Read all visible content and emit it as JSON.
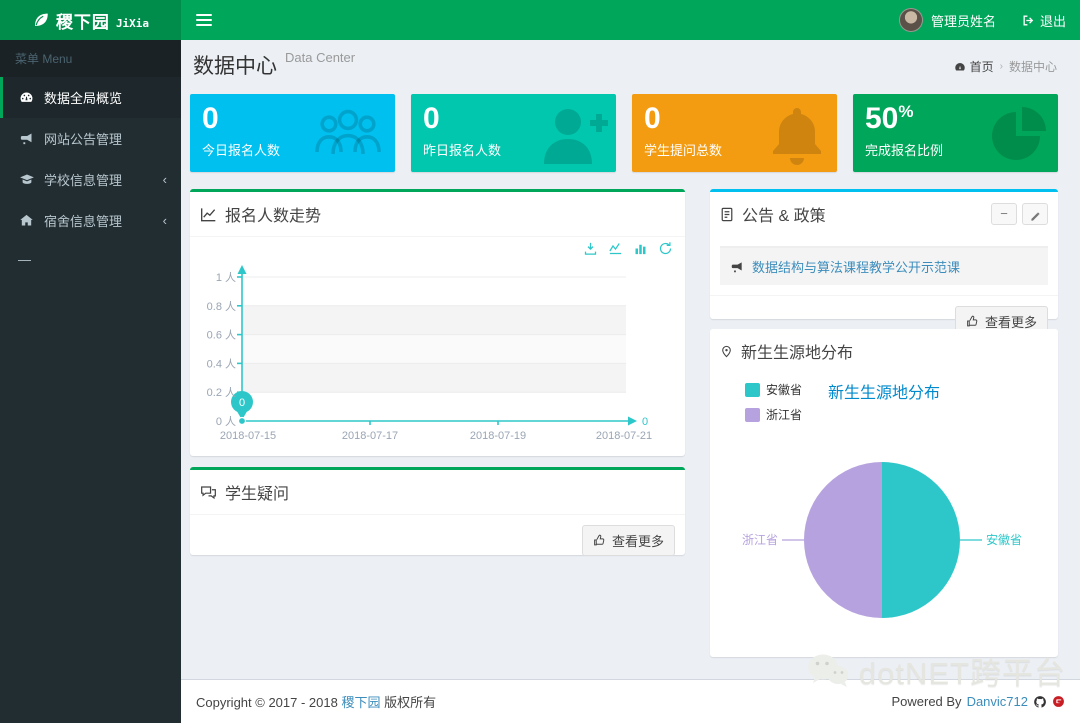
{
  "header": {
    "logo_title": "稷下园",
    "logo_sub": "JiXia",
    "user_name": "管理员姓名",
    "logout_label": "退出"
  },
  "sidebar": {
    "menu_header": "菜单 Menu",
    "items": [
      {
        "label": "数据全局概览",
        "icon": "dashboard-icon",
        "active": true
      },
      {
        "label": "网站公告管理",
        "icon": "bullhorn-icon"
      },
      {
        "label": "学校信息管理",
        "icon": "graduation-cap-icon",
        "expandable": true
      },
      {
        "label": "宿舍信息管理",
        "icon": "home-icon",
        "expandable": true
      },
      {
        "label": "—"
      }
    ]
  },
  "content_header": {
    "title": "数据中心",
    "subtitle": "Data Center",
    "breadcrumb_home": "首页",
    "breadcrumb_current": "数据中心"
  },
  "stat_boxes": [
    {
      "value": "0",
      "label": "今日报名人数",
      "color": "#00c0ef",
      "icon": "users-icon"
    },
    {
      "value": "0",
      "label": "昨日报名人数",
      "color": "#00c7ae",
      "icon": "user-plus-icon"
    },
    {
      "value": "0",
      "label": "学生提问总数",
      "color": "#f39c12",
      "icon": "bell-icon"
    },
    {
      "value": "50",
      "unit": "%",
      "label": "完成报名比例",
      "color": "#00a65a",
      "icon": "pie-chart-icon"
    }
  ],
  "trend_panel": {
    "title": "报名人数走势",
    "toolbox": [
      "download-icon",
      "line-chart-icon",
      "bar-chart-icon",
      "refresh-icon"
    ]
  },
  "announcement_panel": {
    "title": "公告 & 政策",
    "items": [
      {
        "text": "数据结构与算法课程教学公开示范课"
      }
    ],
    "more_label": "查看更多",
    "minus_label": "−"
  },
  "origin_panel": {
    "title": "新生生源地分布",
    "chart_title": "新生生源地分布"
  },
  "questions_panel": {
    "title": "学生疑问",
    "more_label": "查看更多"
  },
  "footer": {
    "copyright_prefix": "Copyright © 2017 - 2018",
    "site_link": "稷下园",
    "copyright_suffix": "版权所有",
    "powered_by": "Powered By",
    "author_link": "Danvic712"
  },
  "watermark": {
    "text": "dotNET跨平台"
  },
  "chart_data": [
    {
      "type": "line",
      "title": "报名人数走势",
      "x_ticks": [
        "2018-07-15",
        "2018-07-17",
        "2018-07-19",
        "2018-07-21"
      ],
      "values": [
        0,
        0,
        0,
        0,
        0,
        0,
        0
      ],
      "y_ticks": [
        "0 人",
        "0.2 人",
        "0.4 人",
        "0.6 人",
        "0.8 人",
        "1 人"
      ],
      "ylim": [
        0,
        1
      ],
      "point_label": "0",
      "end_label": "0",
      "line_color": "#2ec7c9",
      "grid": true,
      "legend_position": "none"
    },
    {
      "type": "pie",
      "title": "新生生源地分布",
      "legend": [
        "安徽省",
        "浙江省"
      ],
      "legend_position": "top-left",
      "slices": [
        {
          "name": "安徽省",
          "percent": 50,
          "color": "#2ec7c9"
        },
        {
          "name": "浙江省",
          "percent": 50,
          "color": "#b6a2de"
        }
      ]
    }
  ]
}
